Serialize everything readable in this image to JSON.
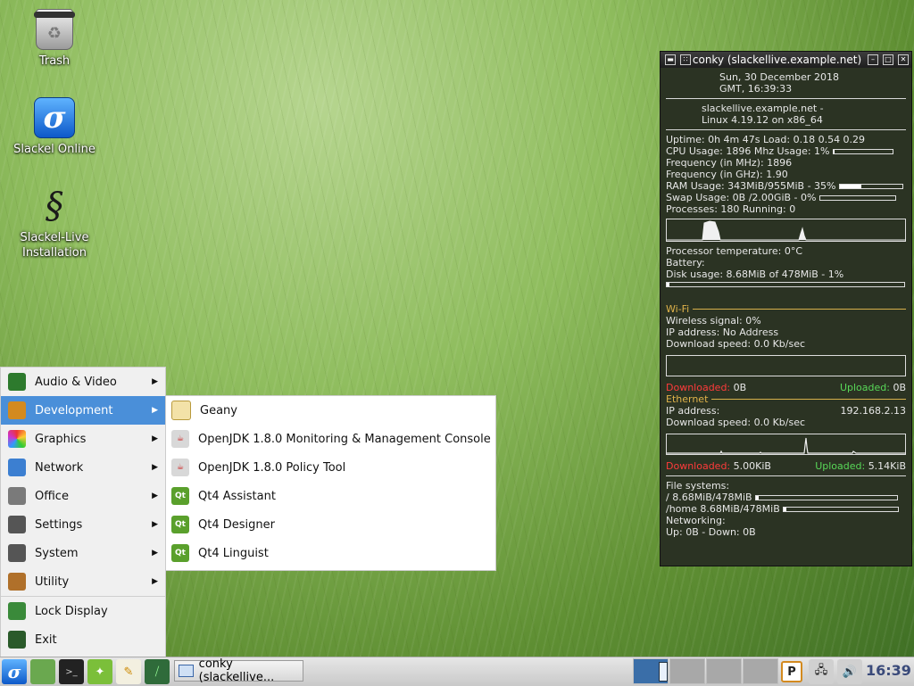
{
  "desktop": {
    "icons": [
      {
        "label": "Trash"
      },
      {
        "label": "Slackel Online"
      },
      {
        "label": "Slackel-Live\nInstallation"
      }
    ]
  },
  "conky": {
    "title": "conky (slackellive.example.net)",
    "date_line1": "Sun,  30 December 2018",
    "date_line2": "GMT,     16:39:33",
    "host_line1": "slackellive.example.net -",
    "host_line2": "Linux 4.19.12 on x86_64",
    "uptime": "Uptime: 0h 4m 47s Load: 0.18 0.54 0.29",
    "cpu": "CPU Usage:  1896 Mhz  Usage:  1%",
    "cpu_percent": 1,
    "freq_mhz": "Frequency (in MHz): 1896",
    "freq_ghz": "Frequency (in GHz): 1.90",
    "ram": "RAM Usage:  343MiB/955MiB - 35%",
    "ram_percent": 35,
    "swap": "Swap Usage:  0B  /2.00GiB - 0%",
    "swap_percent": 0,
    "processes": "Processes:  180   Running:  0",
    "proc_temp": "Processor temperature: 0°C",
    "battery": "Battery:",
    "disk": "Disk usage: 8.68MiB of 478MiB - 1%",
    "disk_percent": 1,
    "wifi_header": "Wi-Fi",
    "wifi_signal": "Wireless signal: 0%",
    "wifi_ip": "IP address: No Address",
    "wifi_download": "Download speed: 0.0 Kb/sec",
    "wifi_downloaded_label": "Downloaded:",
    "wifi_downloaded_value": "0B",
    "wifi_uploaded_label": "Uploaded:",
    "wifi_uploaded_value": "0B",
    "eth_header": "Ethernet",
    "eth_ip_label": "IP address:",
    "eth_ip_value": "192.168.2.13",
    "eth_download": "Download speed: 0.0 Kb/sec",
    "eth_downloaded_label": "Downloaded:",
    "eth_downloaded_value": "5.00KiB",
    "eth_uploaded_label": "Uploaded:",
    "eth_uploaded_value": "5.14KiB",
    "fs_header": "File systems:",
    "fs_root": " / 8.68MiB/478MiB",
    "fs_root_percent": 1.8,
    "fs_home": " /home 8.68MiB/478MiB",
    "fs_home_percent": 1.8,
    "networking": "Networking:",
    "net_updown": " Up: 0B    - Down: 0B"
  },
  "menu": {
    "items": [
      {
        "label": "Audio & Video",
        "color": "#2d7a2d"
      },
      {
        "label": "Development",
        "color": "#d38a1f"
      },
      {
        "label": "Graphics",
        "color": "#d33b8a"
      },
      {
        "label": "Network",
        "color": "#3c7fd1"
      },
      {
        "label": "Office",
        "color": "#7a7a7a"
      },
      {
        "label": "Settings",
        "color": "#555555"
      },
      {
        "label": "System",
        "color": "#555555"
      },
      {
        "label": "Utility",
        "color": "#b0702a"
      }
    ],
    "lock_display": "Lock Display",
    "exit": "Exit"
  },
  "submenu": {
    "items": [
      {
        "label": "Geany"
      },
      {
        "label": "OpenJDK 1.8.0 Monitoring & Management Console"
      },
      {
        "label": "OpenJDK 1.8.0 Policy Tool"
      },
      {
        "label": "Qt4 Assistant"
      },
      {
        "label": "Qt4 Designer"
      },
      {
        "label": "Qt4 Linguist"
      }
    ]
  },
  "taskbar": {
    "task_label": "conky (slackellive...",
    "clock": "16:39"
  }
}
